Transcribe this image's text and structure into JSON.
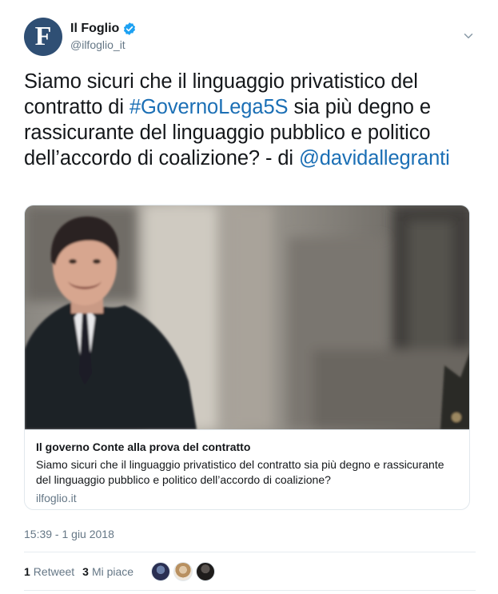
{
  "account": {
    "display_name": "Il Foglio",
    "handle": "@ilfoglio_it",
    "avatar_letter": "F",
    "verified": true
  },
  "tweet": {
    "text_before": "Siamo sicuri che il linguaggio privatistico del contratto di ",
    "hashtag": "#GovernoLega5S",
    "text_middle": " sia più degno e rassicurante del linguaggio pubblico e politico dell’accordo di coalizione? - di ",
    "mention": "@davidallegranti"
  },
  "card": {
    "title": "Il governo Conte alla prova del contratto",
    "description": "Siamo sicuri che il linguaggio privatistico del contratto sia più degno e rassicurante del linguaggio pubblico e politico dell’accordo di coalizione?",
    "domain": "ilfoglio.it"
  },
  "timestamp": "15:39 - 1 giu 2018",
  "stats": {
    "retweets_count": "1",
    "retweets_label": "Retweet",
    "likes_count": "3",
    "likes_label": "Mi piace"
  },
  "colors": {
    "link": "#1b6fb5",
    "verified": "#1da1f2",
    "muted": "#657786"
  },
  "icons": [
    "verified-badge-icon",
    "chevron-down-icon"
  ]
}
